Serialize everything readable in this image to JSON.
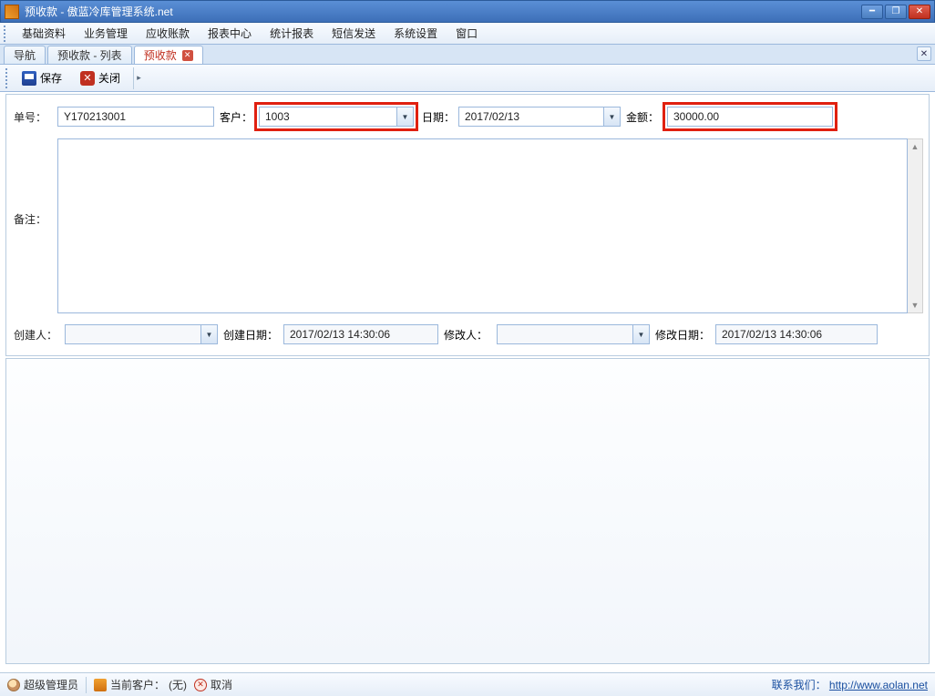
{
  "window": {
    "title": "预收款 - 傲蓝冷库管理系统.net"
  },
  "menu": {
    "items": [
      "基础资料",
      "业务管理",
      "应收账款",
      "报表中心",
      "统计报表",
      "短信发送",
      "系统设置",
      "窗口"
    ]
  },
  "tabs": {
    "items": [
      {
        "label": "导航",
        "closable": false
      },
      {
        "label": "预收款 - 列表",
        "closable": false
      },
      {
        "label": "预收款",
        "closable": true,
        "active": true
      }
    ]
  },
  "toolbar": {
    "save": "保存",
    "close": "关闭"
  },
  "form": {
    "labels": {
      "order_no": "单号：",
      "customer": "客户：",
      "date": "日期：",
      "amount": "金额：",
      "remark": "备注：",
      "creator": "创建人：",
      "create_date": "创建日期：",
      "modifier": "修改人：",
      "modify_date": "修改日期："
    },
    "values": {
      "order_no": "Y170213001",
      "customer": "1003",
      "date": "2017/02/13",
      "amount": "30000.00",
      "remark": "",
      "creator": "",
      "create_date": "2017/02/13 14:30:06",
      "modifier": "",
      "modify_date": "2017/02/13 14:30:06"
    }
  },
  "status": {
    "user": "超级管理员",
    "current_customer_label": "当前客户：",
    "current_customer_value": "(无)",
    "cancel": "取消",
    "contact_label": "联系我们：",
    "contact_url": "http://www.aolan.net"
  }
}
